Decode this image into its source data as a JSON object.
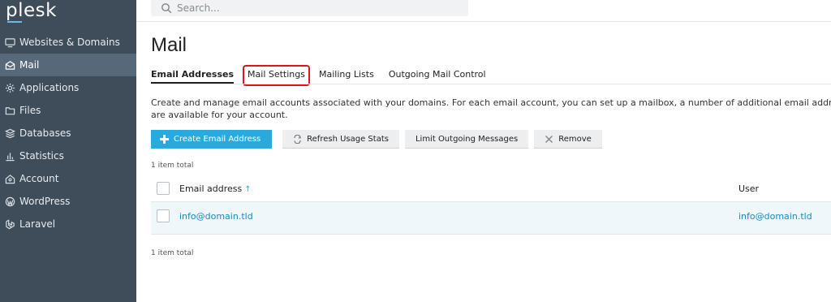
{
  "app": {
    "logo": "plesk"
  },
  "sidebar": {
    "items": [
      {
        "label": "Websites & Domains",
        "icon": "monitor-icon"
      },
      {
        "label": "Mail",
        "icon": "mail-icon",
        "active": true
      },
      {
        "label": "Applications",
        "icon": "gear-icon"
      },
      {
        "label": "Files",
        "icon": "folder-icon"
      },
      {
        "label": "Databases",
        "icon": "database-icon"
      },
      {
        "label": "Statistics",
        "icon": "bar-chart-icon"
      },
      {
        "label": "Account",
        "icon": "account-icon"
      },
      {
        "label": "WordPress",
        "icon": "wordpress-icon"
      },
      {
        "label": "Laravel",
        "icon": "laravel-icon"
      }
    ]
  },
  "search": {
    "placeholder": "Search..."
  },
  "page": {
    "title": "Mail"
  },
  "tabs": [
    {
      "label": "Email Addresses",
      "active": true
    },
    {
      "label": "Mail Settings",
      "highlighted": true
    },
    {
      "label": "Mailing Lists"
    },
    {
      "label": "Outgoing Mail Control"
    }
  ],
  "description": {
    "line1": "Create and manage email accounts associated with your domains. For each email account, you can set up a mailbox, a number of additional email addresses that wil",
    "line2": "are available for your account."
  },
  "toolbar": {
    "create": "Create Email Address",
    "refresh": "Refresh Usage Stats",
    "limit": "Limit Outgoing Messages",
    "remove": "Remove"
  },
  "list": {
    "count_top": "1 item total",
    "count_bottom": "1 item total",
    "columns": {
      "email": "Email address",
      "sort_indicator": "↑",
      "user": "User"
    },
    "rows": [
      {
        "email": "info@domain.tld",
        "user": "info@domain.tld"
      }
    ]
  },
  "colors": {
    "sidebar_bg": "#3f4d5a",
    "sidebar_active": "#56687a",
    "accent": "#28aade",
    "link": "#1a8ac4",
    "highlight_border": "#e0141e"
  }
}
